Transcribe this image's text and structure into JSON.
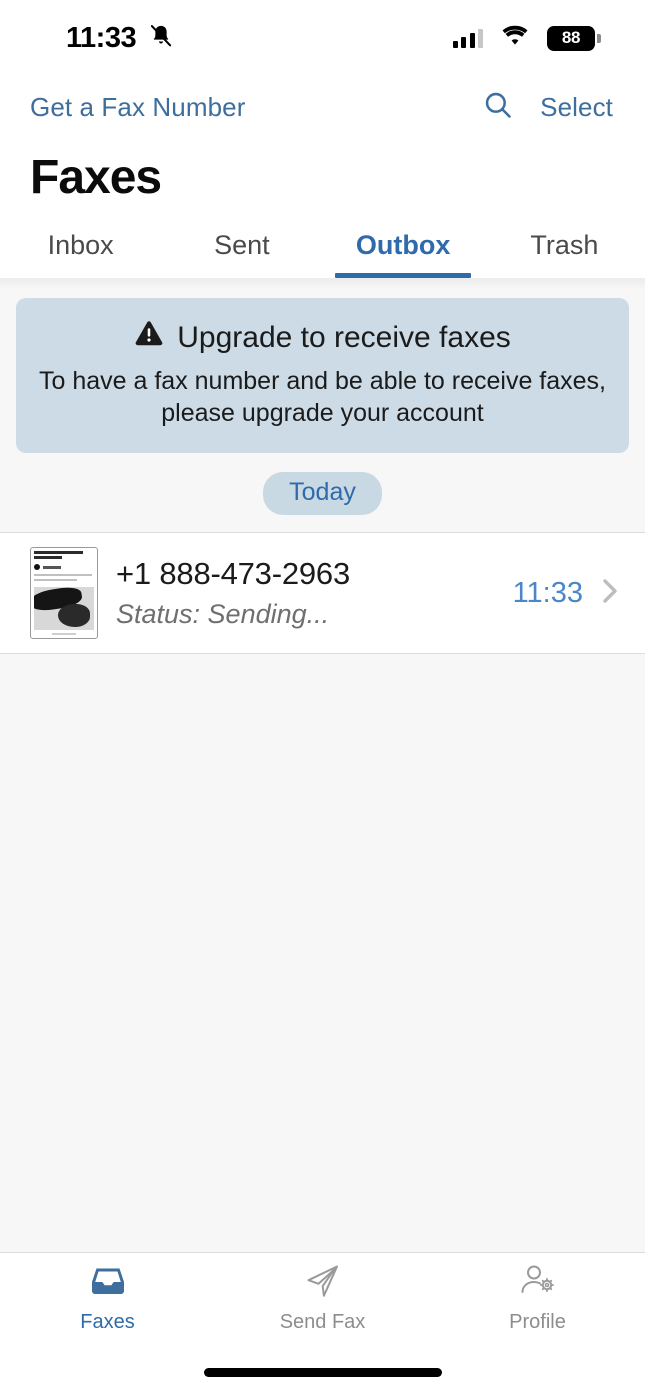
{
  "status_bar": {
    "time": "11:33",
    "silent_icon": "bell-slash-icon",
    "signal_icon": "cellular-signal-icon",
    "wifi_icon": "wifi-icon",
    "battery_level": "88"
  },
  "nav": {
    "left_link": "Get a Fax Number",
    "search_icon": "search-icon",
    "select_label": "Select"
  },
  "header": {
    "title": "Faxes"
  },
  "tabs": [
    {
      "label": "Inbox",
      "active": false
    },
    {
      "label": "Sent",
      "active": false
    },
    {
      "label": "Outbox",
      "active": true
    },
    {
      "label": "Trash",
      "active": false
    }
  ],
  "banner": {
    "warning_icon": "warning-triangle-icon",
    "title": "Upgrade to receive faxes",
    "line1": "To have a fax number and be able to receive faxes,",
    "line2": "please upgrade your account"
  },
  "date_separator": "Today",
  "fax_list": [
    {
      "thumbnail": "fax-document-thumbnail",
      "number": "+1 888-473-2963",
      "status": "Status: Sending...",
      "time": "11:33",
      "chevron": "chevron-right-icon"
    }
  ],
  "bottom_tabs": [
    {
      "label": "Faxes",
      "icon": "inbox-tray-icon",
      "active": true
    },
    {
      "label": "Send Fax",
      "icon": "paper-plane-icon",
      "active": false
    },
    {
      "label": "Profile",
      "icon": "person-gear-icon",
      "active": false
    }
  ],
  "colors": {
    "accent_blue": "#2f6aab",
    "link_blue": "#3d6e9e",
    "banner_bg": "#ccdbe5",
    "pill_bg": "#c8d9e3",
    "page_bg": "#f7f7f7",
    "inactive_gray": "#8d8d8d"
  }
}
